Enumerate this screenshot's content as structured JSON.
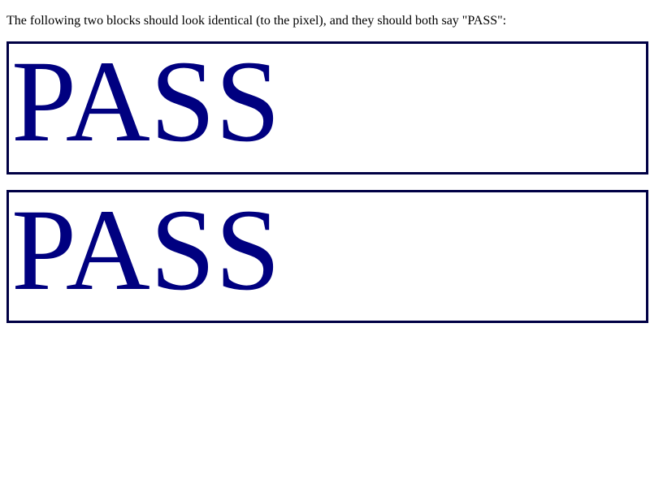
{
  "intro_text": "The following two blocks should look identical (to the pixel), and they should both say \"PASS\":",
  "blocks": [
    {
      "text": "PASS"
    },
    {
      "text": "PASS"
    }
  ],
  "colors": {
    "text": "#000080",
    "border": "#000044",
    "background": "#ffffff"
  }
}
